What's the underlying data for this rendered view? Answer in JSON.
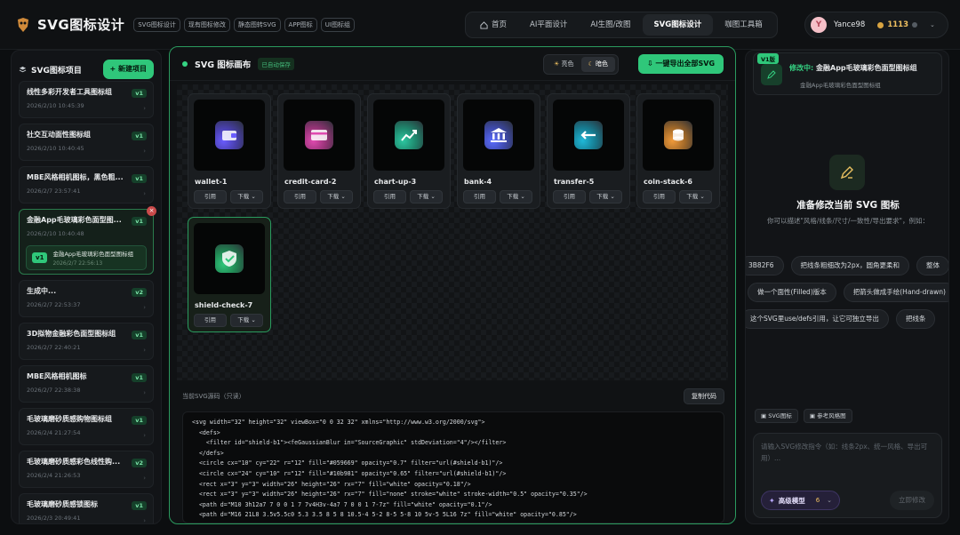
{
  "app": {
    "title": "SVG图标设计"
  },
  "top_tags": [
    "SVG图标设计",
    "现有图标修改",
    "静态图转SVG",
    "APP图标",
    "UI图标组"
  ],
  "nav": [
    {
      "label": "首页",
      "icon": "home-icon"
    },
    {
      "label": "AI平面设计"
    },
    {
      "label": "AI生图/改图"
    },
    {
      "label": "SVG图标设计",
      "active": true
    },
    {
      "label": "咖图工具箱"
    }
  ],
  "user": {
    "avatar_initial": "Y",
    "name": "Yance98",
    "credits": "1113"
  },
  "left_panel": {
    "title": "SVG图标项目",
    "new_button": "+ 新建项目",
    "projects": [
      {
        "name": "线性多彩开发者工具图标组",
        "date": "2026/2/10 10:45:39",
        "version": "v1"
      },
      {
        "name": "社交互动面性图标组",
        "date": "2026/2/10 10:40:45",
        "version": "v1"
      },
      {
        "name": "MBE风格相机图标，黑色粗...",
        "date": "2026/2/7 23:57:41",
        "version": "v1"
      },
      {
        "name": "金融App毛玻璃彩色面型图...",
        "date": "2026/2/10 10:40:48",
        "version": "v1",
        "active": true,
        "sub": {
          "version": "v1",
          "name": "金融App毛玻璃彩色面型图标组",
          "date": "2026/2/7 22:56:13"
        }
      },
      {
        "name": "生成中...",
        "date": "2026/2/7 22:53:37",
        "version": "v2"
      },
      {
        "name": "3D拟物金融彩色面型图标组",
        "date": "2026/2/7 22:40:21",
        "version": "v1"
      },
      {
        "name": "MBE风格相机图标",
        "date": "2026/2/7 22:38:38",
        "version": "v1"
      },
      {
        "name": "毛玻璃磨砂质感购物图标组",
        "date": "2026/2/4 21:27:54",
        "version": "v1"
      },
      {
        "name": "毛玻璃磨砂质感彩色线性购...",
        "date": "2026/2/4 21:26:53",
        "version": "v2"
      },
      {
        "name": "毛玻璃磨砂质感锁图标",
        "date": "2026/2/3 20:49:41",
        "version": "v1"
      }
    ]
  },
  "canvas": {
    "title": "SVG 图标画布",
    "autosave": "已自动保存",
    "theme_light": "亮色",
    "theme_dark": "暗色",
    "export_button": "一键导出全部SVG",
    "use_label": "引用",
    "download_label": "下载",
    "icons": [
      {
        "name": "wallet-1",
        "icon": "wallet-icon",
        "color": "#6a5cff"
      },
      {
        "name": "credit-card-2",
        "icon": "credit-card-icon",
        "color": "#e04ab0"
      },
      {
        "name": "chart-up-3",
        "icon": "chart-up-icon",
        "color": "#2cc7a0"
      },
      {
        "name": "bank-4",
        "icon": "bank-icon",
        "color": "#5b6cff"
      },
      {
        "name": "transfer-5",
        "icon": "transfer-icon",
        "color": "#1fb8d8"
      },
      {
        "name": "coin-stack-6",
        "icon": "coin-stack-icon",
        "color": "#f09a3a"
      },
      {
        "name": "shield-check-7",
        "icon": "shield-check-icon",
        "color": "#2fc77a",
        "selected": true
      }
    ]
  },
  "code": {
    "title": "当前SVG源码（只读）",
    "copy_button": "复制代码",
    "lines": [
      "<svg width=\"32\" height=\"32\" viewBox=\"0 0 32 32\" xmlns=\"http://www.w3.org/2000/svg\">",
      "  <defs>",
      "    <filter id=\"shield-b1\"><feGaussianBlur in=\"SourceGraphic\" stdDeviation=\"4\"/></filter>",
      "  </defs>",
      "  <circle cx=\"10\" cy=\"22\" r=\"12\" fill=\"#059669\" opacity=\"0.7\" filter=\"url(#shield-b1)\"/>",
      "  <circle cx=\"24\" cy=\"10\" r=\"12\" fill=\"#10b981\" opacity=\"0.65\" filter=\"url(#shield-b1)\"/>",
      "  <rect x=\"3\" y=\"3\" width=\"26\" height=\"26\" rx=\"7\" fill=\"white\" opacity=\"0.18\"/>",
      "  <rect x=\"3\" y=\"3\" width=\"26\" height=\"26\" rx=\"7\" fill=\"none\" stroke=\"white\" stroke-width=\"0.5\" opacity=\"0.35\"/>",
      "  <path d=\"M10 3h12a7 7 0 0 1 7 7v4H3v-4a7 7 0 0 1 7-7z\" fill=\"white\" opacity=\"0.1\"/>",
      "  <path d=\"M16 21L8 3.5v5.5c0 5.3 3.5 8 5 8 10.5-4 5-2 8-5 5-8 10 5v-5 5L16 7z\" fill=\"white\" opacity=\"0.85\"/>"
    ]
  },
  "right_panel": {
    "edit_badge": "V1版",
    "editing_prefix": "修改中:",
    "editing_name": "金融App毛玻璃彩色面型图标组",
    "editing_sub": "金融App毛玻璃彩色面型图标组",
    "ready_title": "准备修改当前 SVG 图标",
    "ready_desc": "你可以描述\"风格/线条/尺寸/一致性/导出要求\"，例如：",
    "chips_row1": [
      "3B82F6",
      "把线条粗细改为2px，圆角更柔和",
      "整体"
    ],
    "chips_row2": [
      "做一个面性(Filled)版本",
      "把箭头做成手绘(Hand-drawn)"
    ],
    "chips_row3": [
      "这个SVG里use/defs引用，让它可独立导出",
      "把线条"
    ],
    "ref_svg": "SVG图标",
    "ref_style": "参考风格图",
    "prompt_placeholder": "请输入SVG修改指令（如：线条2px、统一风格、导出可用）...",
    "model_label": "高级模型",
    "model_count": "6",
    "submit_label": "立即修改"
  }
}
